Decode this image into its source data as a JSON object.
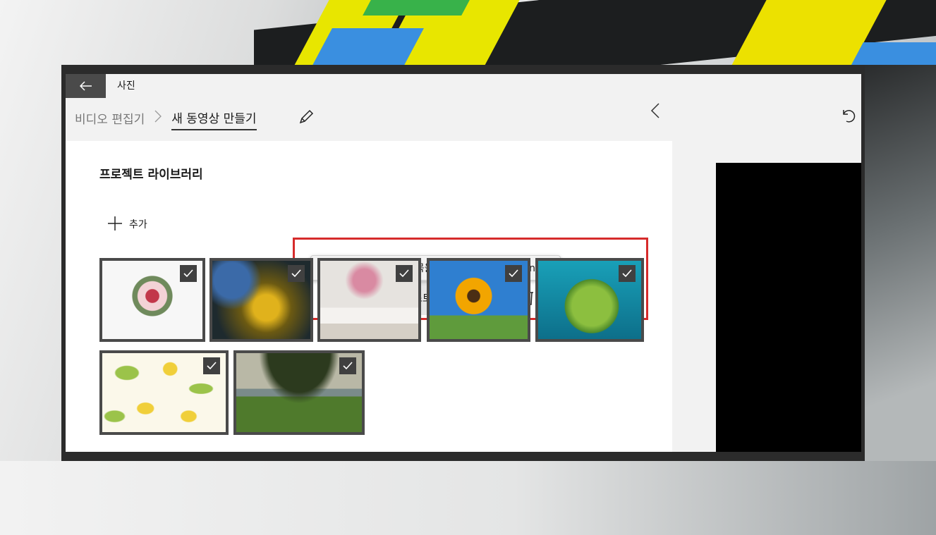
{
  "window": {
    "app_title": "사진",
    "back_icon": "arrow-left-icon"
  },
  "breadcrumb": {
    "parent": "비디오 편집기",
    "separator": ">",
    "current": "새 동영상 만들기"
  },
  "library": {
    "title": "프로젝트 라이브러리",
    "add_label": "추가",
    "tooltip": "스토리보드에 선택한 항목을 추가하세요 – (Ctrl+Enter)",
    "place_label": "스토리보드에 놓기",
    "highlight_color": "#d62b2b",
    "items": [
      {
        "name": "flower-bouquet",
        "selected": true
      },
      {
        "name": "yellow-flowers",
        "selected": true
      },
      {
        "name": "vase-books",
        "selected": true
      },
      {
        "name": "sunflower",
        "selected": true
      },
      {
        "name": "green-planet",
        "selected": true
      },
      {
        "name": "leaf-pattern",
        "selected": true
      },
      {
        "name": "tree-beach",
        "selected": true
      }
    ]
  }
}
